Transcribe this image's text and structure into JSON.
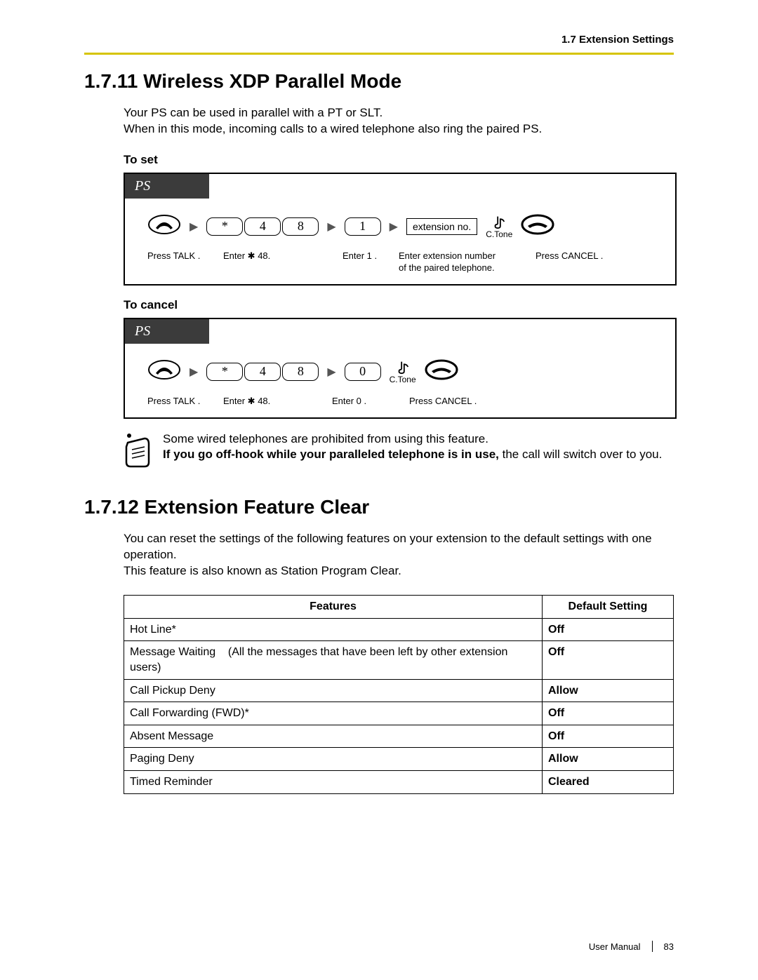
{
  "header": {
    "text": "1.7 Extension Settings"
  },
  "section1": {
    "heading": "1.7.11   Wireless XDP Parallel Mode",
    "intro1": "Your PS can be used in parallel with a PT or SLT.",
    "intro2": "When in this mode, incoming calls to a wired telephone also ring the paired PS.",
    "to_set_label": "To set",
    "to_cancel_label": "To cancel",
    "ps_tab": "PS",
    "keys": {
      "star": "*",
      "k4": "4",
      "k8": "8",
      "k1": "1",
      "k0": "0"
    },
    "ext_no": "extension no.",
    "ctone": "C.Tone",
    "captions": {
      "press_talk": "Press TALK .",
      "enter_star48": "Enter ✱ 48.",
      "enter_1": "Enter 1 .",
      "enter_0": "Enter 0 .",
      "enter_ext1": "Enter extension number",
      "enter_ext2": "of the paired telephone.",
      "press_cancel": "Press CANCEL ."
    },
    "note1": "Some wired telephones are prohibited from using this feature.",
    "note2a": "If you go off-hook while your paralleled telephone is in use, ",
    "note2b": "the call will switch over to you."
  },
  "section2": {
    "heading": "1.7.12   Extension Feature Clear",
    "intro1": "You can reset the settings of the following features on your extension to the default settings with one operation.",
    "intro2": "This feature is also known as Station Program Clear.",
    "table": {
      "col_features": "Features",
      "col_default": "Default Setting",
      "rows": [
        {
          "feature": "Hot Line*",
          "default": "Off"
        },
        {
          "feature": "Message Waiting",
          "sub": "(All the messages that have been left by other extension users)",
          "default": "Off"
        },
        {
          "feature": "Call Pickup Deny",
          "default": "Allow"
        },
        {
          "feature": "Call Forwarding (FWD)*",
          "default": "Off"
        },
        {
          "feature": "Absent Message",
          "default": "Off"
        },
        {
          "feature": "Paging Deny",
          "default": "Allow"
        },
        {
          "feature": "Timed Reminder",
          "default": "Cleared"
        }
      ]
    }
  },
  "footer": {
    "label": "User Manual",
    "page": "83"
  }
}
